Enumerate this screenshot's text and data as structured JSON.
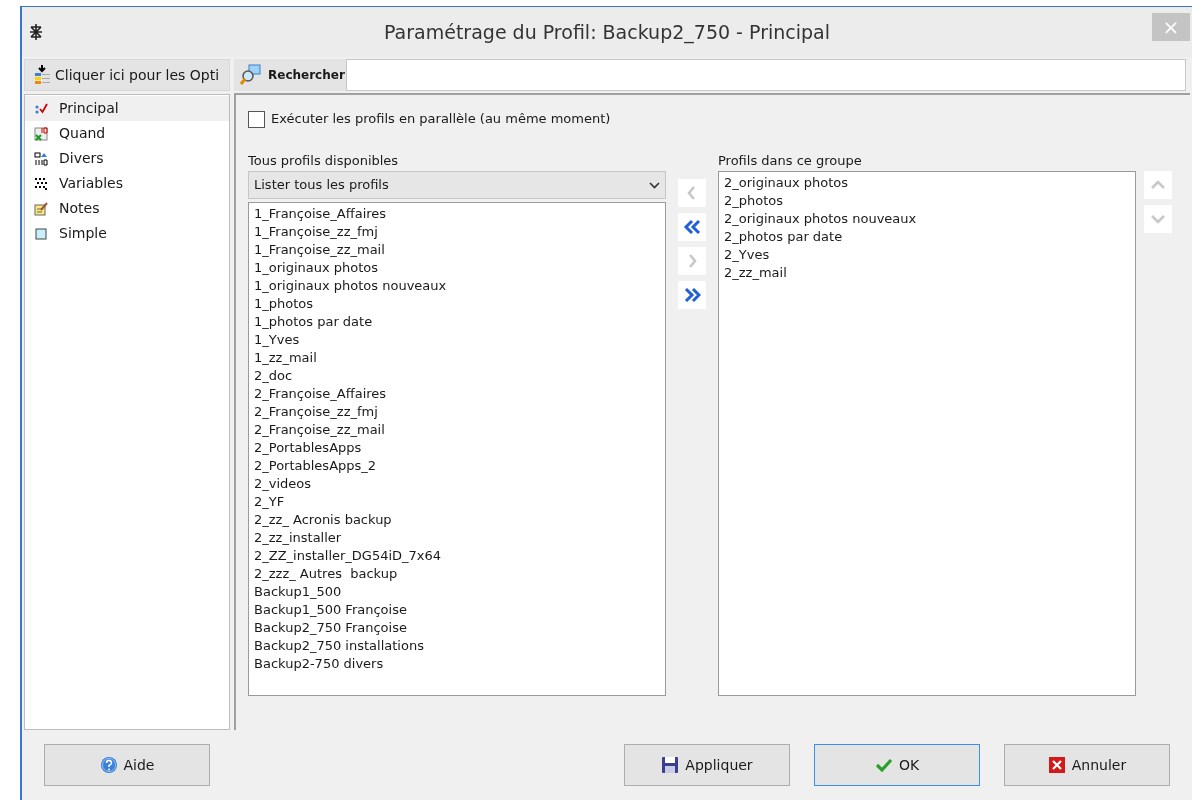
{
  "window": {
    "title": "Paramétrage du Profil: Backup2_750 - Principal",
    "close": "×"
  },
  "options_button": {
    "label": "Cliquer ici pour les Opti"
  },
  "sidebar": {
    "items": [
      {
        "label": "Principal",
        "kind": "principal",
        "selected": true
      },
      {
        "label": "Quand",
        "kind": "quand",
        "selected": false
      },
      {
        "label": "Divers",
        "kind": "divers",
        "selected": false
      },
      {
        "label": "Variables",
        "kind": "variables",
        "selected": false
      },
      {
        "label": "Notes",
        "kind": "notes",
        "selected": false
      },
      {
        "label": "Simple",
        "kind": "simple",
        "selected": false
      }
    ]
  },
  "search": {
    "label": "Rechercher"
  },
  "parallel": {
    "label": "Exécuter les profils en parallèle (au même moment)",
    "checked": false
  },
  "available": {
    "heading": "Tous profils disponibles",
    "filter": "Lister tous les profils",
    "items": [
      "1_Françoise_Affaires",
      "1_Françoise_zz_fmj",
      "1_Françoise_zz_mail",
      "1_originaux photos",
      "1_originaux photos nouveaux",
      "1_photos",
      "1_photos par date",
      "1_Yves",
      "1_zz_mail",
      "2_doc",
      "2_Françoise_Affaires",
      "2_Françoise_zz_fmj",
      "2_Françoise_zz_mail",
      "2_PortablesApps",
      "2_PortablesApps_2",
      "2_videos",
      "2_YF",
      "2_zz_ Acronis backup",
      "2_zz_installer",
      "2_ZZ_installer_DG54iD_7x64",
      "2_zzz_ Autres  backup",
      "Backup1_500",
      "Backup1_500 Françoise",
      "Backup2_750 Françoise",
      "Backup2_750 installations",
      "Backup2-750 divers"
    ]
  },
  "transfer_buttons": [
    {
      "kind": "left",
      "disabled": true
    },
    {
      "kind": "all-left",
      "disabled": false
    },
    {
      "kind": "right",
      "disabled": true
    },
    {
      "kind": "all-right",
      "disabled": false
    }
  ],
  "group": {
    "heading": "Profils dans ce groupe",
    "items": [
      "2_originaux photos",
      "2_photos",
      "2_originaux photos nouveaux",
      "2_photos par date",
      "2_Yves",
      "2_zz_mail"
    ]
  },
  "order_buttons": [
    {
      "kind": "up",
      "disabled": true
    },
    {
      "kind": "down",
      "disabled": true
    }
  ],
  "buttons": [
    {
      "label": "Aide",
      "kind": "help",
      "default": false
    },
    {
      "label": "Appliquer",
      "kind": "save",
      "default": false
    },
    {
      "label": "OK",
      "kind": "ok",
      "default": true
    },
    {
      "label": "Annuler",
      "kind": "cancel",
      "default": false
    }
  ]
}
